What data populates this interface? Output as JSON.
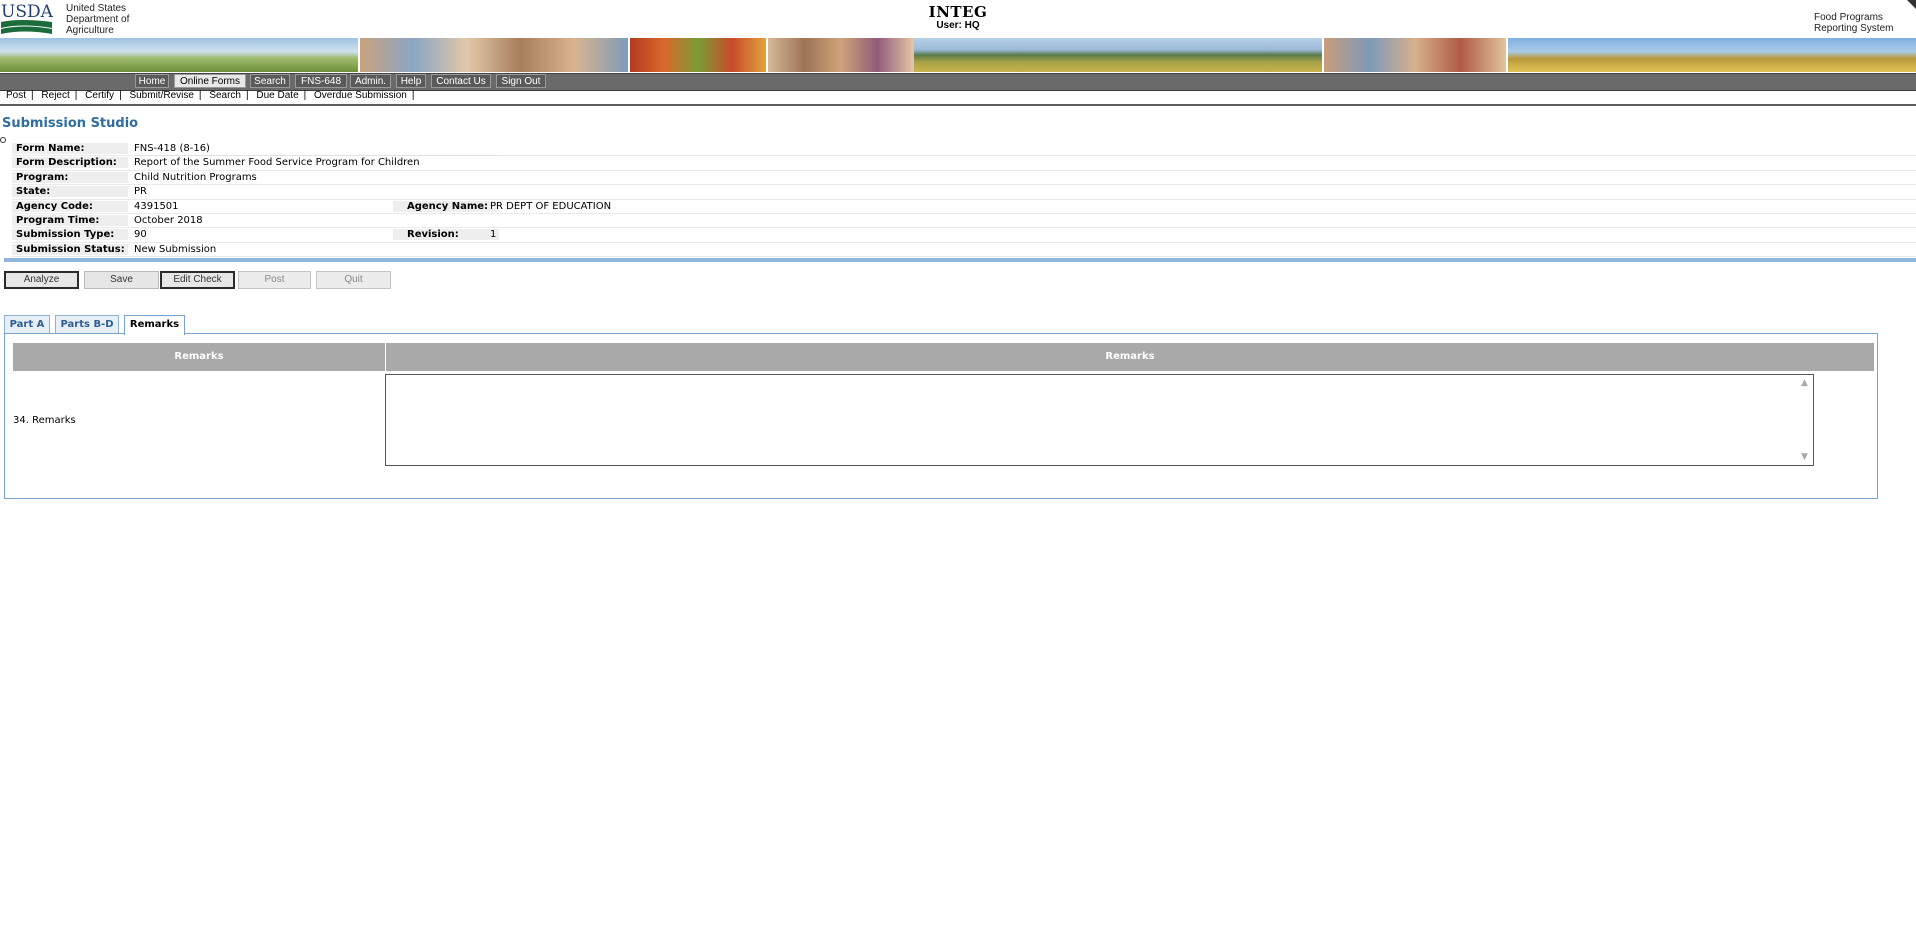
{
  "header": {
    "logo_text": "USDA",
    "agency": "United States Department of Agriculture",
    "environment": "INTEG",
    "user": "User: HQ",
    "system_name": "Food Programs Reporting System"
  },
  "nav": {
    "items": [
      {
        "label": "Home"
      },
      {
        "label": "Online Forms",
        "active": true
      },
      {
        "label": "Search"
      },
      {
        "label": "FNS-648"
      },
      {
        "label": "Admin."
      },
      {
        "label": "Help"
      },
      {
        "label": "Contact Us"
      },
      {
        "label": "Sign Out"
      }
    ]
  },
  "subnav": {
    "links": [
      "Post",
      "Reject",
      "Certify",
      "Submit/Revise",
      "Search",
      "Due Date",
      "Overdue Submission"
    ],
    "separator": "|"
  },
  "page": {
    "title": "Submission Studio"
  },
  "submission": {
    "form_name_label": "Form Name:",
    "form_name": "FNS-418 (8-16)",
    "form_description_label": "Form Description:",
    "form_description": "Report of the Summer Food Service Program for Children",
    "program_label": "Program:",
    "program": "Child Nutrition Programs",
    "state_label": "State:",
    "state": "PR",
    "agency_code_label": "Agency Code:",
    "agency_code": "4391501",
    "agency_name_label": "Agency Name:",
    "agency_name": "PR DEPT OF EDUCATION",
    "program_time_label": "Program Time:",
    "program_time": "October 2018",
    "submission_type_label": "Submission Type:",
    "submission_type": "90",
    "revision_label": "Revision:",
    "revision": "1",
    "submission_status_label": "Submission Status:",
    "submission_status": "New Submission"
  },
  "actions": {
    "analyze": "Analyze",
    "save": "Save",
    "edit_check": "Edit Check",
    "post": "Post",
    "quit": "Quit"
  },
  "tabs": [
    {
      "label": "Part A"
    },
    {
      "label": "Parts B-D"
    },
    {
      "label": "Remarks",
      "active": true
    }
  ],
  "remarks_table": {
    "col1_header": "Remarks",
    "col2_header": "Remarks",
    "row_label": "34. Remarks",
    "row_value": ""
  },
  "colors": {
    "title_blue": "#2e6e9e",
    "nav_gray": "#6a6a6a",
    "header_gray": "#a9a9a9",
    "tab_border": "#7aa3d0",
    "usda_green": "#1c6b3a",
    "usda_blue": "#1f3f76"
  }
}
